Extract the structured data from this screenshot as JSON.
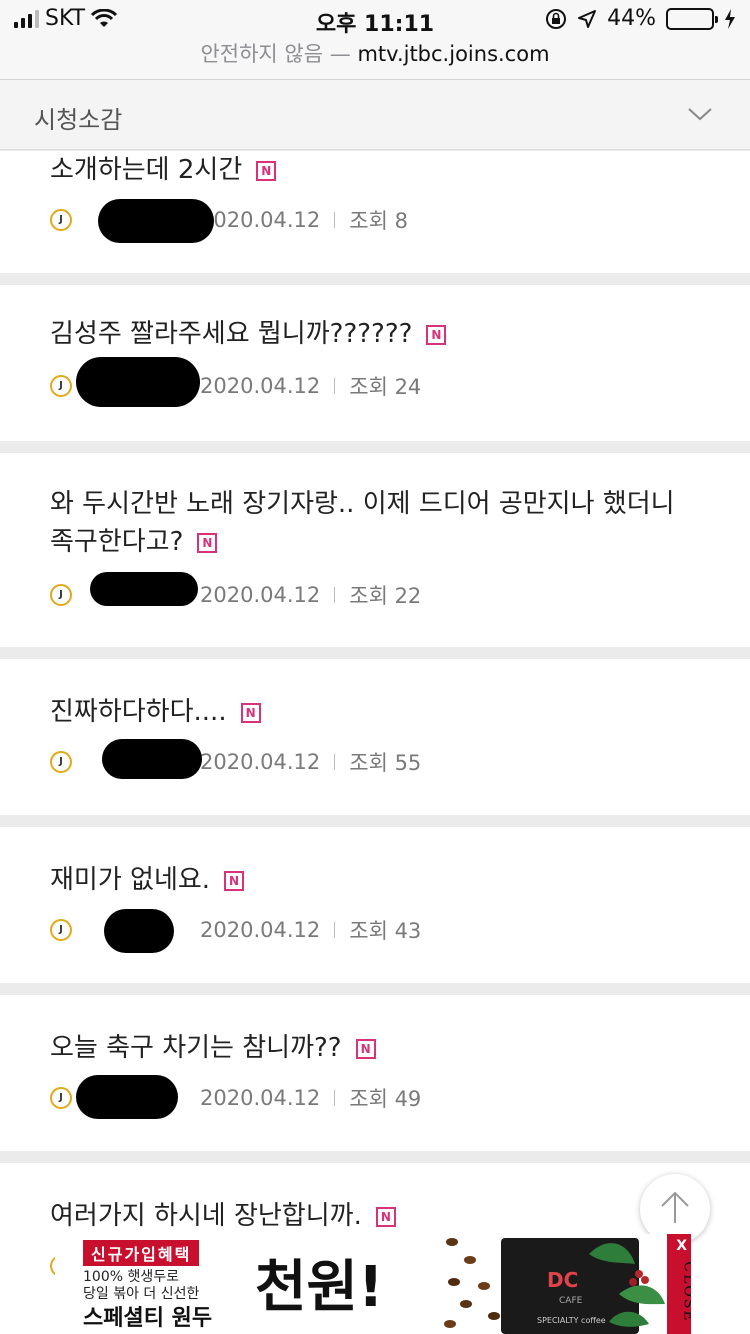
{
  "status_bar": {
    "carrier": "SKT",
    "time": "오후 11:11",
    "battery": "44%",
    "battery_level": 0.44
  },
  "url_bar": {
    "warning": "안전하지 않음",
    "dash": "—",
    "host": "mtv.jtbc.joins.com"
  },
  "category": {
    "label": "시청소감"
  },
  "posts": [
    {
      "title": "소개하는데 2시간",
      "new_badge": "N",
      "author_icon": "J",
      "date": "2020.04.12",
      "views": "조회 8"
    },
    {
      "title": "김성주 짤라주세요 뭡니까??????",
      "new_badge": "N",
      "author_icon": "J",
      "date": "2020.04.12",
      "views": "조회 24"
    },
    {
      "title": "와 두시간반 노래 장기자랑.. 이제 드디어 공만지나 했더니 족구한다고?",
      "new_badge": "N",
      "author_icon": "J",
      "date": "2020.04.12",
      "views": "조회 22"
    },
    {
      "title": "진짜하다하다....",
      "new_badge": "N",
      "author_icon": "J",
      "date": "2020.04.12",
      "views": "조회 55"
    },
    {
      "title": "재미가 없네요.",
      "new_badge": "N",
      "author_icon": "J",
      "date": "2020.04.12",
      "views": "조회 43"
    },
    {
      "title": "오늘 축구 차기는 참니까??",
      "new_badge": "N",
      "author_icon": "J",
      "date": "2020.04.12",
      "views": "조회 49"
    },
    {
      "title": "여러가지 하시네 장난합니까.",
      "new_badge": "N",
      "author_icon": "J",
      "date": "",
      "views": ""
    }
  ],
  "ad": {
    "badge": "신규가입혜택",
    "line1": "100% 햇생두로",
    "line2": "당일 볶아 더 신선한",
    "product": "스페셜티 원두",
    "price": "천원!",
    "logo": "DC",
    "logo_sub": "CAFE",
    "pack_tag": "SPECIALTY coffee",
    "close_x": "X",
    "close_label": "CLOSE"
  },
  "icons": {
    "chevron": "chevron-down-icon",
    "top": "arrow-up-icon",
    "wifi": "wifi-icon",
    "signal": "signal-icon",
    "location": "location-arrow-icon",
    "lock_rotation": "orientation-lock-icon",
    "charging": "charging-bolt-icon"
  },
  "colors": {
    "new_badge": "#d6337c",
    "author_ring": "#e3a91b",
    "battery_fill": "#4cd964",
    "ad_red": "#c8102e"
  }
}
